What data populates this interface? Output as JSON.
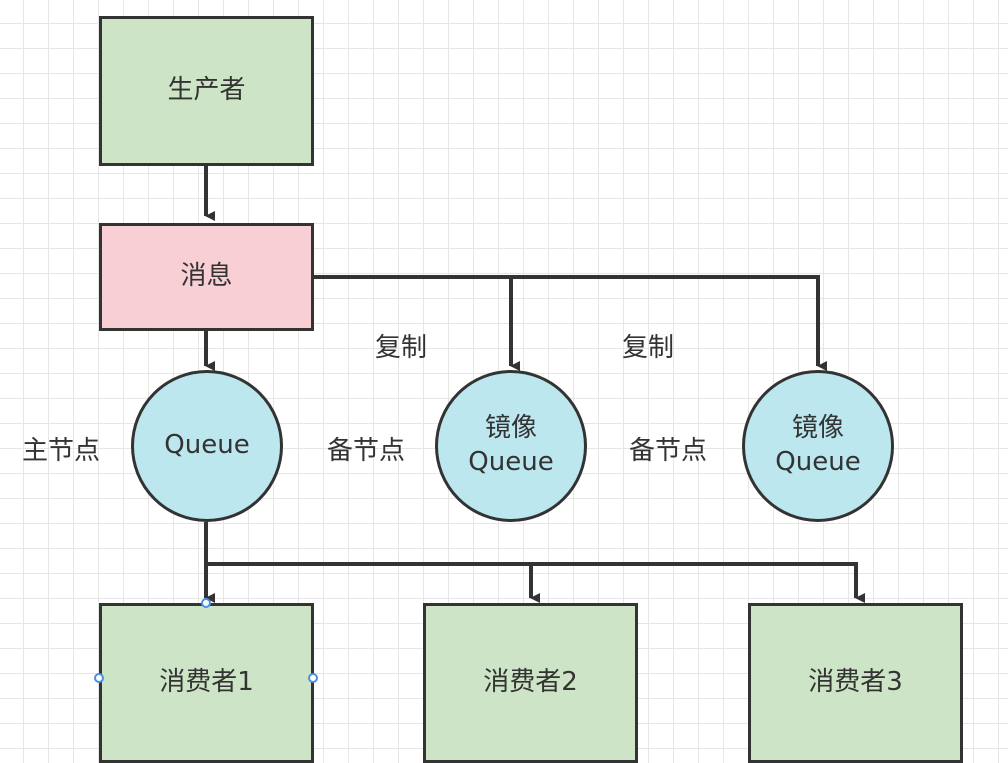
{
  "producer": {
    "label": "生产者"
  },
  "message": {
    "label": "消息"
  },
  "queues": {
    "master": {
      "label": "Queue",
      "role": "主节点"
    },
    "mirror1": {
      "line1": "镜像",
      "line2": "Queue",
      "role": "备节点",
      "edge_label": "复制"
    },
    "mirror2": {
      "line1": "镜像",
      "line2": "Queue",
      "role": "备节点",
      "edge_label": "复制"
    }
  },
  "consumers": [
    {
      "label": "消费者1"
    },
    {
      "label": "消费者2"
    },
    {
      "label": "消费者3"
    }
  ],
  "colors": {
    "rect_green": "#cde5c6",
    "rect_pink": "#f7cfd4",
    "circle_fill": "#bce7ef",
    "stroke": "#333333",
    "selection": "#4a90e2"
  }
}
